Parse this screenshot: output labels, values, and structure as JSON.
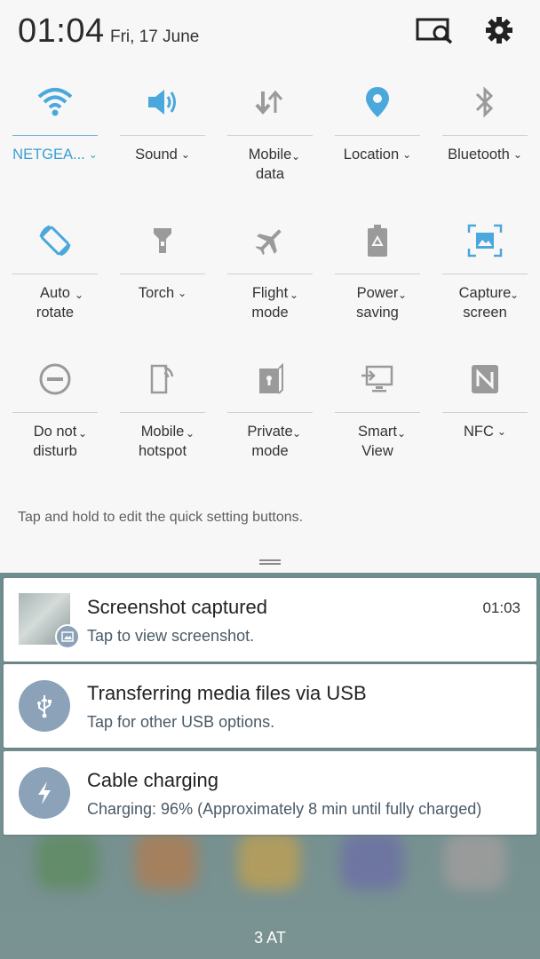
{
  "status": {
    "time": "01:04",
    "date": "Fri, 17 June"
  },
  "quick_settings": [
    {
      "label": "NETGEA...",
      "icon": "wifi-icon",
      "active": true
    },
    {
      "label": "Sound",
      "icon": "volume-icon"
    },
    {
      "label": "Mobile\ndata",
      "icon": "mobile-data-icon"
    },
    {
      "label": "Location",
      "icon": "location-pin-icon",
      "active_icon": true
    },
    {
      "label": "Bluetooth",
      "icon": "bluetooth-icon"
    },
    {
      "label": "Auto\nrotate",
      "icon": "auto-rotate-icon",
      "active_icon": true
    },
    {
      "label": "Torch",
      "icon": "torch-icon"
    },
    {
      "label": "Flight\nmode",
      "icon": "airplane-icon"
    },
    {
      "label": "Power\nsaving",
      "icon": "battery-recycle-icon"
    },
    {
      "label": "Capture\nscreen",
      "icon": "capture-screen-icon",
      "active_icon": true
    },
    {
      "label": "Do not\ndisturb",
      "icon": "do-not-disturb-icon"
    },
    {
      "label": "Mobile\nhotspot",
      "icon": "hotspot-icon"
    },
    {
      "label": "Private\nmode",
      "icon": "private-mode-icon"
    },
    {
      "label": "Smart\nView",
      "icon": "smart-view-icon"
    },
    {
      "label": "NFC",
      "icon": "nfc-icon"
    }
  ],
  "hint": "Tap and hold to edit the quick setting buttons.",
  "notifications": [
    {
      "title": "Screenshot captured",
      "subtitle": "Tap to view screenshot.",
      "time": "01:03"
    },
    {
      "title": "Transferring media files via USB",
      "subtitle": "Tap for other USB options."
    },
    {
      "title": "Cable charging",
      "subtitle": "Charging: 96% (Approximately 8 min until fully charged)"
    }
  ],
  "carrier": "3 AT",
  "colors": {
    "accent": "#3a9ed6",
    "icon_gray": "#9a9a9a",
    "notif_icon_bg": "#8ba2b8"
  }
}
